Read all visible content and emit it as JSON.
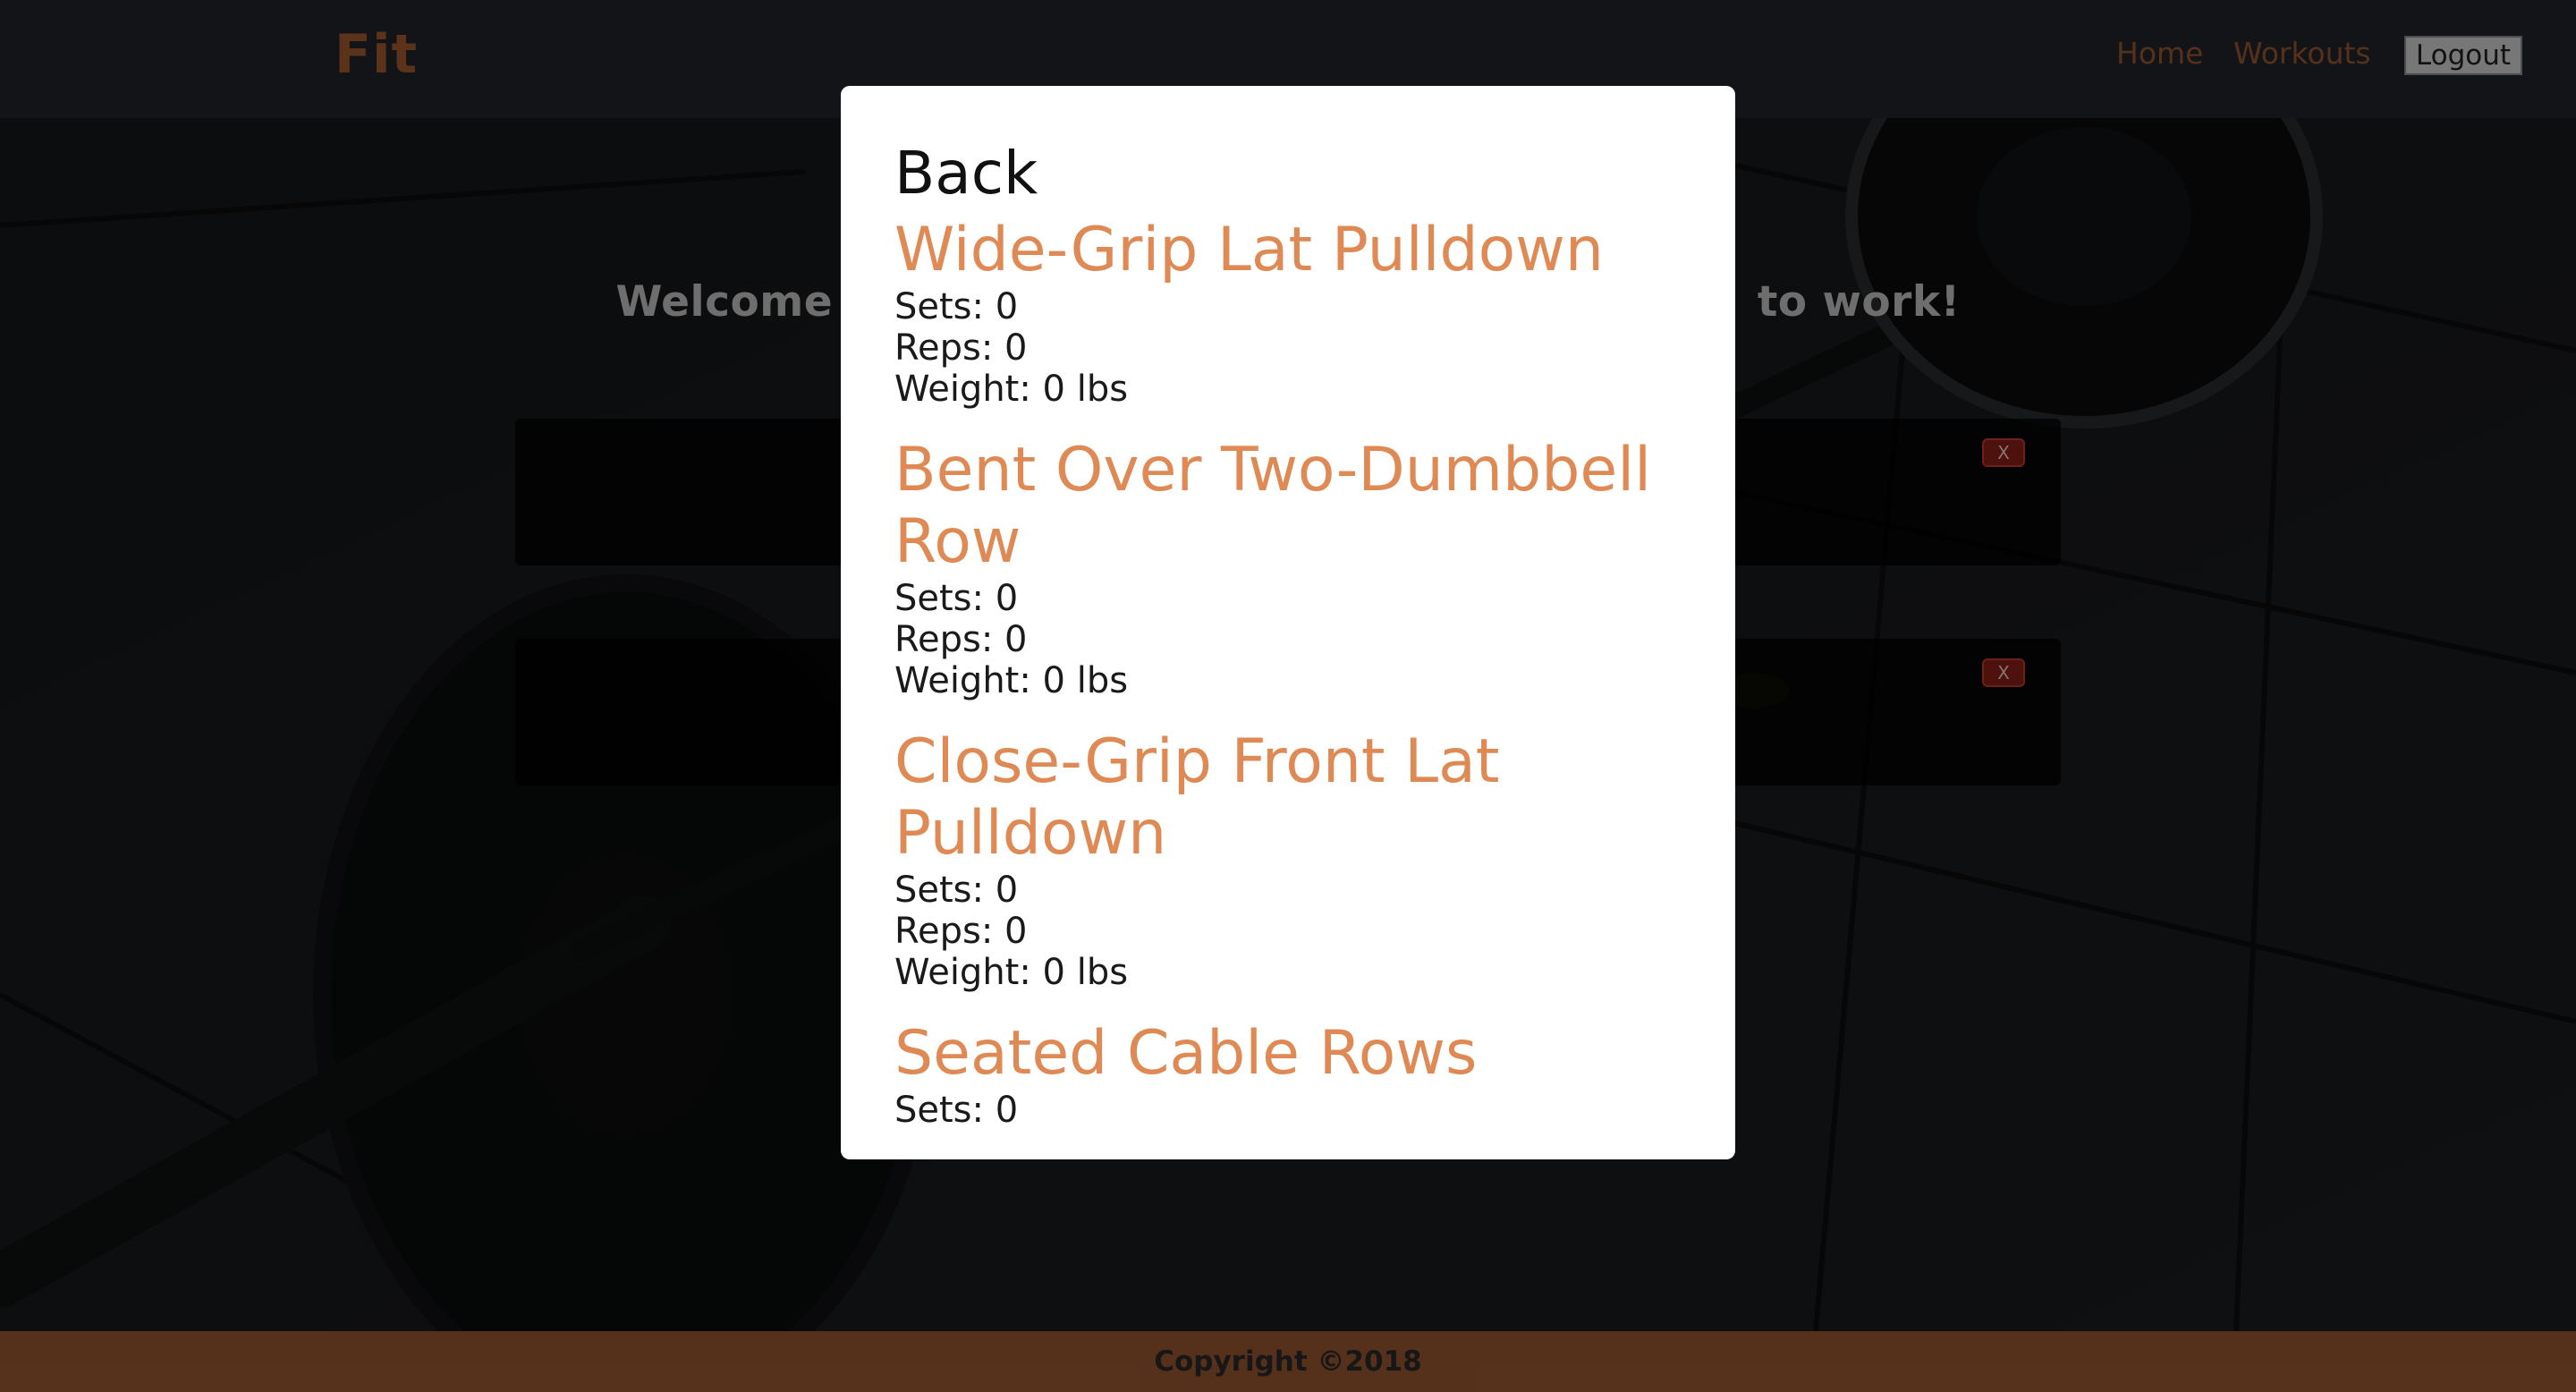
{
  "navbar": {
    "brand": "Fit",
    "links": [
      {
        "label": "Home"
      },
      {
        "label": "Workouts"
      }
    ],
    "logout_label": "Logout"
  },
  "main": {
    "welcome_left": "Welcome",
    "welcome_right": "to work!",
    "cards": [
      {
        "delete_label": "X"
      },
      {
        "delete_label": "X"
      }
    ]
  },
  "modal": {
    "back_label": "Back",
    "exercises": [
      {
        "name": "Wide-Grip Lat Pulldown",
        "sets": "Sets: 0",
        "reps": "Reps: 0",
        "weight": "Weight: 0 lbs"
      },
      {
        "name": "Bent Over Two-Dumbbell Row",
        "sets": "Sets: 0",
        "reps": "Reps: 0",
        "weight": "Weight: 0 lbs"
      },
      {
        "name": "Close-Grip Front Lat Pulldown",
        "sets": "Sets: 0",
        "reps": "Reps: 0",
        "weight": "Weight: 0 lbs"
      },
      {
        "name": "Seated Cable Rows",
        "sets": "Sets: 0"
      }
    ]
  },
  "footer": {
    "copyright": "Copyright ©2018"
  },
  "colors": {
    "brand": "#a65d31",
    "accent": "#df8a55",
    "footer_bg": "#9c5a33",
    "navbar_bg": "#23252b",
    "delete_red": "#8c1f1a"
  }
}
